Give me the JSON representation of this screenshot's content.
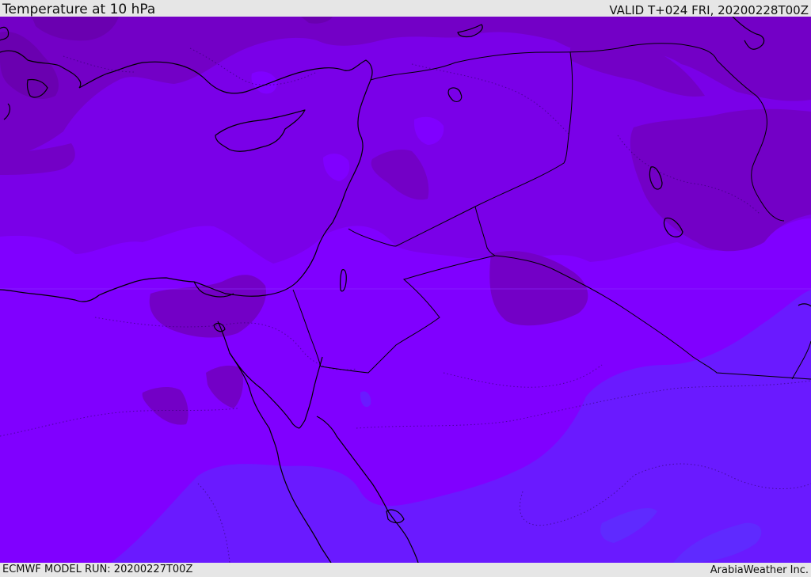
{
  "header": {
    "title": "Temperature at 10 hPa",
    "valid": "VALID T+024 FRI, 20200228T00Z"
  },
  "footer": {
    "model_run": "ECMWF MODEL RUN: 20200227T00Z",
    "credit": "ArabiaWeather Inc."
  },
  "map": {
    "colors": {
      "darkest": "#6a00b0",
      "dark": "#7300c6",
      "mid": "#7a00e8",
      "light": "#8000ff",
      "blue": "#6a1aff",
      "bluer": "#5f2aff",
      "coast": "#000000"
    }
  }
}
